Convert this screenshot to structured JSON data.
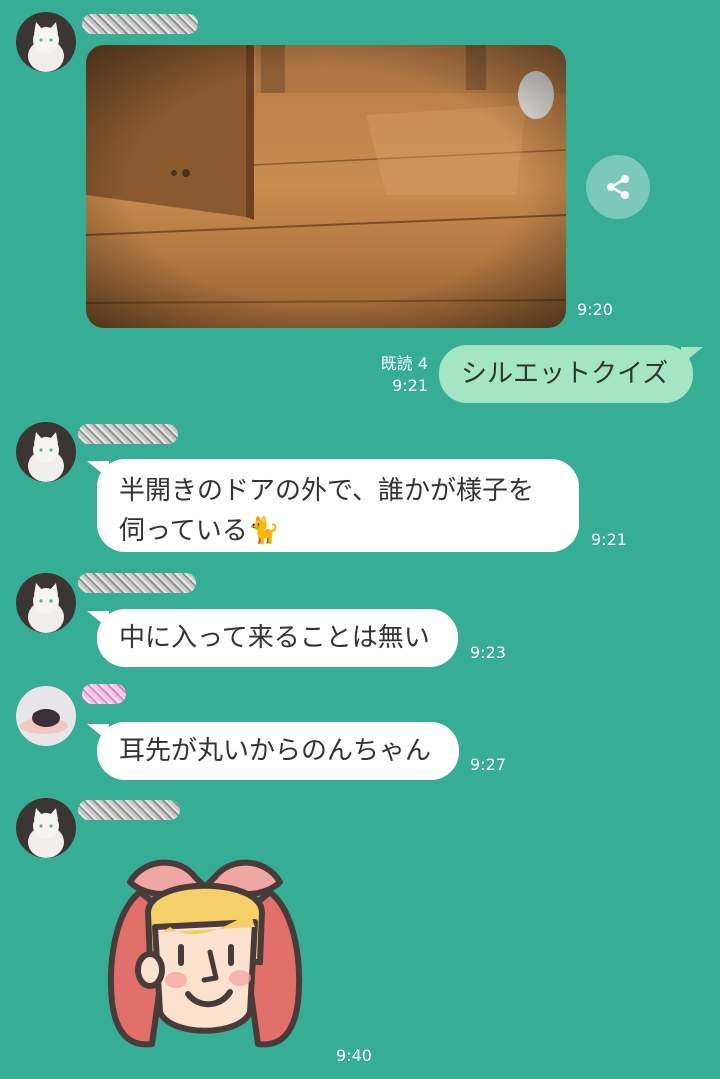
{
  "messages": {
    "m1": {
      "time": "9:20"
    },
    "m2": {
      "text": "シルエットクイズ",
      "read_label": "既読 4",
      "time": "9:21"
    },
    "m3": {
      "line1": "半開きのドアの外で、誰かが様子を",
      "line2": "伺っている",
      "emoji": "🐈",
      "time": "9:21"
    },
    "m4": {
      "text": "中に入って来ることは無い",
      "time": "9:23"
    },
    "m5": {
      "text": "耳先が丸いからのんちゃん",
      "time": "9:27"
    },
    "m6": {
      "time": "9:40"
    }
  },
  "colors": {
    "background": "#36ad95",
    "own_bubble": "#a4e6c3",
    "other_bubble": "#ffffff"
  },
  "icons": [
    "share-icon",
    "cat-avatar",
    "hamster-avatar",
    "sticker-character"
  ]
}
